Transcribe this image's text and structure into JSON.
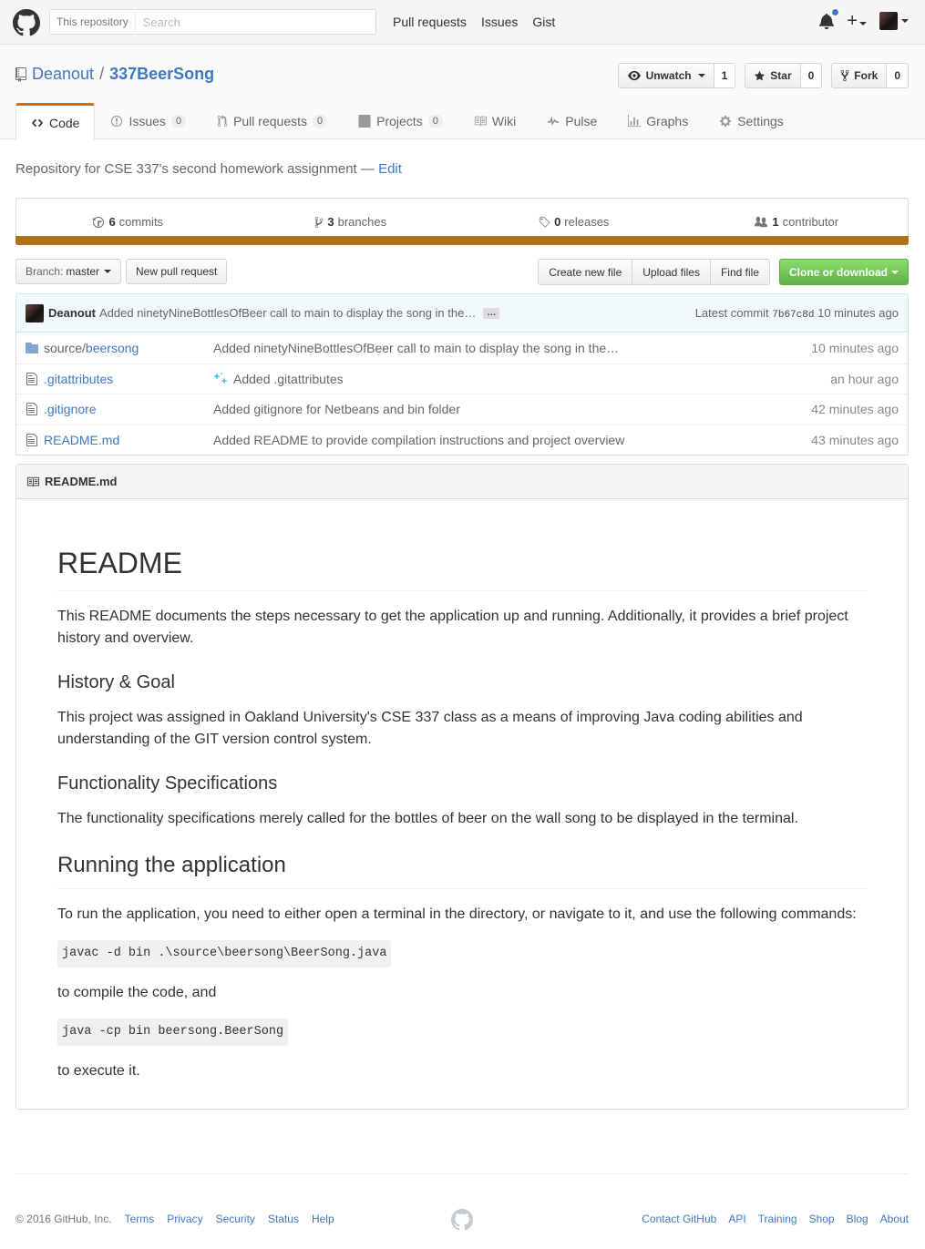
{
  "header": {
    "search_scope": "This repository",
    "search_placeholder": "Search",
    "nav": [
      "Pull requests",
      "Issues",
      "Gist"
    ]
  },
  "repo": {
    "owner": "Deanout",
    "separator": "/",
    "name": "337BeerSong",
    "watch_label": "Unwatch",
    "watch_count": "1",
    "star_label": "Star",
    "star_count": "0",
    "fork_label": "Fork",
    "fork_count": "0"
  },
  "tabs": [
    {
      "label": "Code",
      "counter": ""
    },
    {
      "label": "Issues",
      "counter": "0"
    },
    {
      "label": "Pull requests",
      "counter": "0"
    },
    {
      "label": "Projects",
      "counter": "0"
    },
    {
      "label": "Wiki",
      "counter": ""
    },
    {
      "label": "Pulse",
      "counter": ""
    },
    {
      "label": "Graphs",
      "counter": ""
    },
    {
      "label": "Settings",
      "counter": ""
    }
  ],
  "description": {
    "text": "Repository for CSE 337's second homework assignment",
    "dash": "—",
    "edit": "Edit"
  },
  "summary": {
    "commits_num": "6",
    "commits_label": "commits",
    "branches_num": "3",
    "branches_label": "branches",
    "releases_num": "0",
    "releases_label": "releases",
    "contributors_num": "1",
    "contributors_label": "contributor"
  },
  "language_color": "#b07219",
  "file_nav": {
    "branch_label": "Branch:",
    "branch_value": "master",
    "new_pr": "New pull request",
    "create_file": "Create new file",
    "upload_files": "Upload files",
    "find_file": "Find file",
    "clone": "Clone or download"
  },
  "latest_commit": {
    "author": "Deanout",
    "message": "Added ninetyNineBottlesOfBeer call to main to display the song in the…",
    "ellipsis": "…",
    "prefix": "Latest commit",
    "sha": "7b67c8d",
    "age": "10 minutes ago"
  },
  "files": [
    {
      "name_prefix": "source/",
      "name": "beersong",
      "message": "Added ninetyNineBottlesOfBeer call to main to display the song in the…",
      "age": "10 minutes ago"
    },
    {
      "name_prefix": "",
      "name": ".gitattributes",
      "message": "Added .gitattributes",
      "age": "an hour ago"
    },
    {
      "name_prefix": "",
      "name": ".gitignore",
      "message": "Added gitignore for Netbeans and bin folder",
      "age": "42 minutes ago"
    },
    {
      "name_prefix": "",
      "name": "README.md",
      "message": "Added README to provide compilation instructions and project overview",
      "age": "43 minutes ago"
    }
  ],
  "readme": {
    "filename": "README.md",
    "h1": "README",
    "p1": "This README documents the steps necessary to get the application up and running. Additionally, it provides a brief project history and overview.",
    "h3a": "History & Goal",
    "p2": "This project was assigned in Oakland University's CSE 337 class as a means of improving Java coding abilities and understanding of the GIT version control system.",
    "h3b": "Functionality Specifications",
    "p3": "The functionality specifications merely called for the bottles of beer on the wall song to be displayed in the terminal.",
    "h2": "Running the application",
    "p4": "To run the application, you need to either open a terminal in the directory, or navigate to it, and use the following commands:",
    "code1": "javac -d bin .\\source\\beersong\\BeerSong.java",
    "p5": "to compile the code, and",
    "code2": "java -cp bin beersong.BeerSong",
    "p6": "to execute it."
  },
  "footer": {
    "copyright": "© 2016 GitHub, Inc.",
    "left_links": [
      "Terms",
      "Privacy",
      "Security",
      "Status",
      "Help"
    ],
    "right_links": [
      "Contact GitHub",
      "API",
      "Training",
      "Shop",
      "Blog",
      "About"
    ]
  }
}
